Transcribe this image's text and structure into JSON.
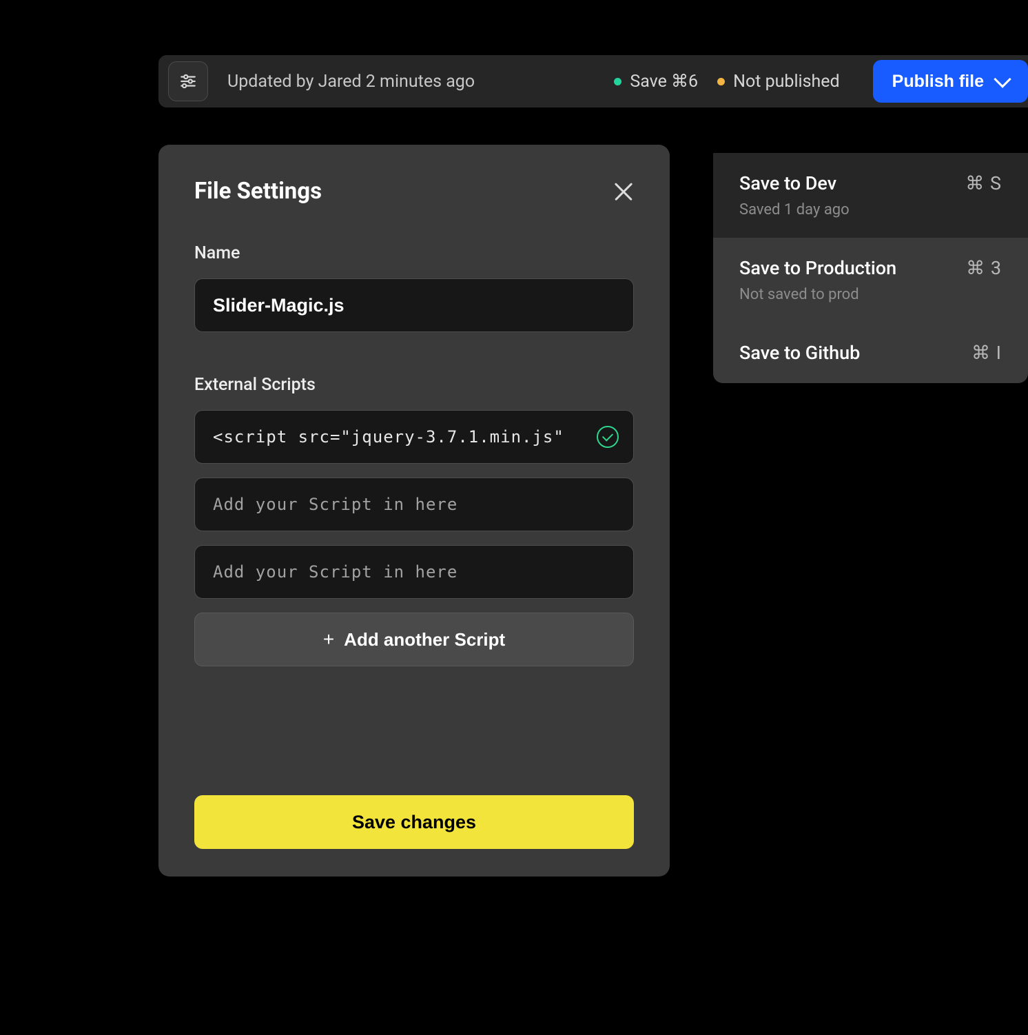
{
  "topbar": {
    "updated_text": "Updated by Jared 2 minutes ago",
    "save_status": "Save ⌘6",
    "publish_status": "Not published",
    "publish_button": "Publish file"
  },
  "dropdown": {
    "items": [
      {
        "title": "Save to Dev",
        "shortcut": "⌘ S",
        "sub": "Saved 1 day ago"
      },
      {
        "title": "Save to Production",
        "shortcut": "⌘ 3",
        "sub": "Not saved to prod"
      },
      {
        "title": "Save to Github",
        "shortcut": "⌘ I",
        "sub": ""
      }
    ]
  },
  "panel": {
    "title": "File Settings",
    "name_label": "Name",
    "name_value": "Slider-Magic.js",
    "scripts_label": "External Scripts",
    "scripts": [
      {
        "value": "<script src=\"jquery-3.7.1.min.js\"",
        "placeholder": "Add your Script in here",
        "valid": true
      },
      {
        "value": "",
        "placeholder": "Add your Script in here",
        "valid": false
      },
      {
        "value": "",
        "placeholder": "Add your Script in here",
        "valid": false
      }
    ],
    "add_script_label": "Add another Script",
    "save_button": "Save changes"
  },
  "colors": {
    "accent_blue": "#185cff",
    "accent_yellow": "#f2e43a",
    "ok_green": "#2fd68e",
    "status_green": "#22d39b",
    "status_amber": "#f2b544"
  }
}
